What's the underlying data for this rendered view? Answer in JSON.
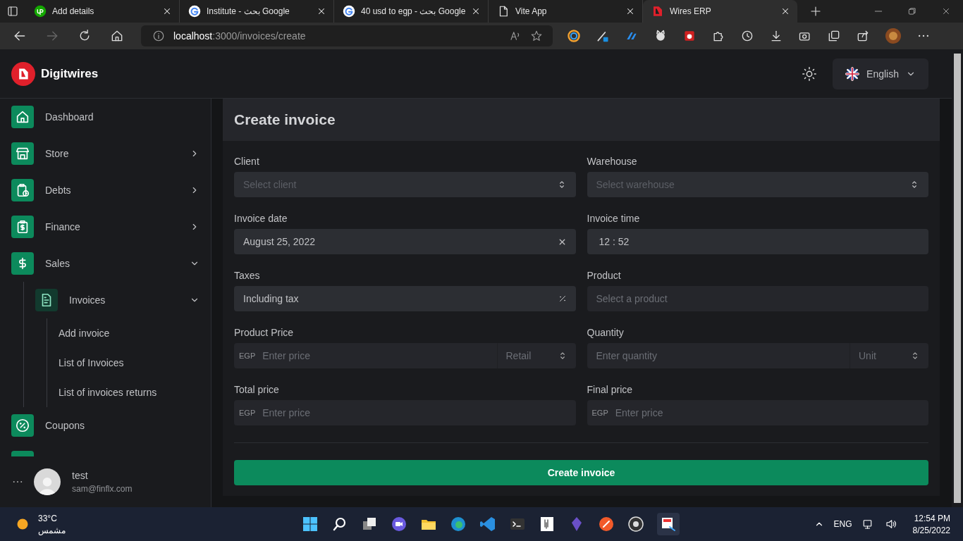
{
  "browser": {
    "tabs": [
      {
        "title": "Add details",
        "kind": "site",
        "selected": false
      },
      {
        "title": "Institute - بحث Google",
        "kind": "search",
        "selected": false
      },
      {
        "title": "40 usd to egp - بحث Google",
        "kind": "search",
        "selected": false
      },
      {
        "title": "Vite App",
        "kind": "page",
        "selected": false
      },
      {
        "title": "Wires ERP",
        "kind": "app",
        "selected": true
      }
    ],
    "address": {
      "host": "localhost",
      "path": ":3000/invoices/create"
    }
  },
  "header": {
    "brand": "Digitwires",
    "language": "English"
  },
  "sidebar": {
    "items": [
      {
        "label": "Dashboard",
        "selected": false
      },
      {
        "label": "Store",
        "selected": false,
        "expanded": false
      },
      {
        "label": "Debts",
        "selected": false,
        "expanded": false
      },
      {
        "label": "Finance",
        "selected": false,
        "expanded": false
      },
      {
        "label": "Sales",
        "selected": false,
        "expanded": true,
        "children": [
          {
            "label": "Invoices",
            "selected": true,
            "expanded": true,
            "children": [
              {
                "label": "Add invoice"
              },
              {
                "label": "List of Invoices"
              },
              {
                "label": "List of invoices returns"
              }
            ]
          }
        ]
      },
      {
        "label": "Coupons",
        "selected": false
      }
    ],
    "user": {
      "name": "test",
      "email": "sam@finflx.com"
    }
  },
  "form": {
    "title": "Create invoice",
    "fields": [
      {
        "label": "Client",
        "kind": "select",
        "placeholder": "Select client",
        "disabled": false
      },
      {
        "label": "Warehouse",
        "kind": "select",
        "placeholder": "Select warehouse",
        "disabled": false
      },
      {
        "label": "Invoice date",
        "kind": "date",
        "value": "August 25, 2022",
        "disabled": false
      },
      {
        "label": "Invoice time",
        "kind": "time",
        "value": "12 : 52",
        "disabled": false
      },
      {
        "label": "Taxes",
        "kind": "tax",
        "value": "Including tax",
        "disabled": false
      },
      {
        "label": "Product",
        "kind": "plain",
        "placeholder": "Select a product",
        "disabled": true
      },
      {
        "label": "Product Price",
        "kind": "money",
        "prefix": "EGP",
        "placeholder": "Enter price",
        "unit": "Retail",
        "disabled": true
      },
      {
        "label": "Quantity",
        "kind": "money",
        "placeholder": "Enter quantity",
        "unit": "Unit",
        "disabled": true
      },
      {
        "label": "Total price",
        "kind": "money",
        "prefix": "EGP",
        "placeholder": "Enter price",
        "disabled": true
      },
      {
        "label": "Final price",
        "kind": "money",
        "prefix": "EGP",
        "placeholder": "Enter price",
        "disabled": true
      }
    ],
    "submit": "Create invoice"
  },
  "taskbar": {
    "temperature": "33°C",
    "weather": "مشمس",
    "language": "ENG",
    "time": "12:54 PM",
    "date": "8/25/2022"
  }
}
